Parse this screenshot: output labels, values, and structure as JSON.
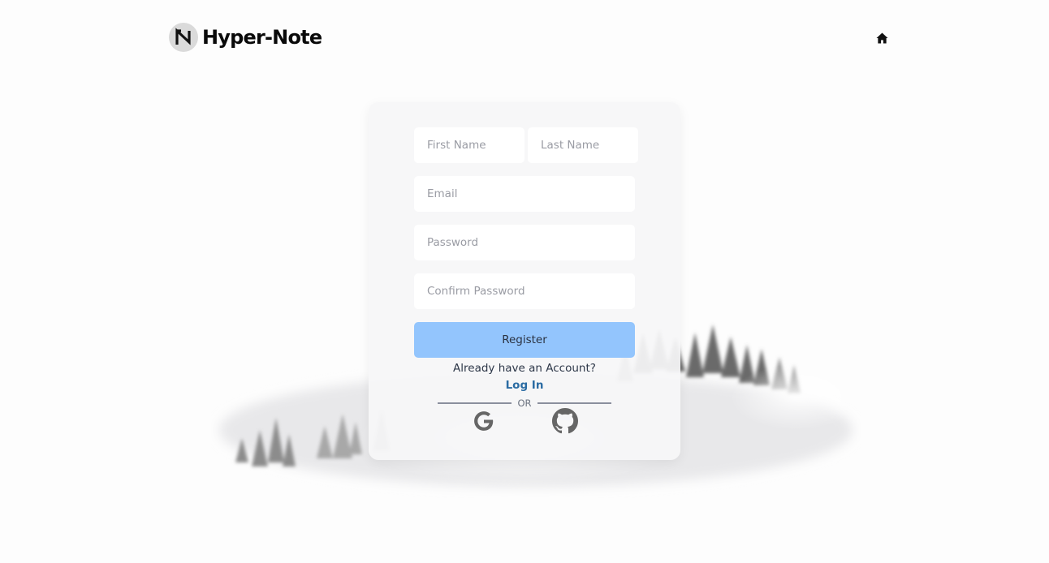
{
  "header": {
    "logo_text": "Hyper-Note",
    "home_icon": "home-icon"
  },
  "form": {
    "first_name_placeholder": "First Name",
    "last_name_placeholder": "Last Name",
    "email_placeholder": "Email",
    "password_placeholder": "Password",
    "confirm_password_placeholder": "Confirm Password",
    "register_label": "Register",
    "already_text": "Already have an Account?",
    "login_link": "Log In",
    "or_text": "OR",
    "social_icons": [
      "google-icon",
      "github-icon"
    ]
  },
  "colors": {
    "register_button": "#93c5fd",
    "login_link": "#2b6ca3",
    "card_background": "#f6f6f8"
  }
}
